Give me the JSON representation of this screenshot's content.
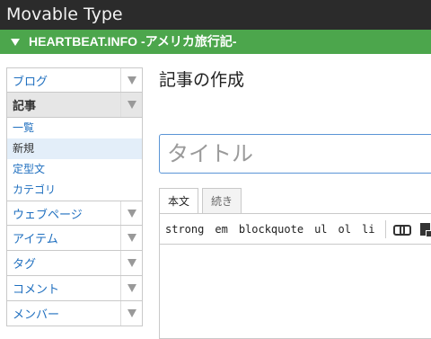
{
  "app": {
    "name": "Movable Type"
  },
  "site": {
    "name": "HEARTBEAT.INFO -アメリカ旅行記-"
  },
  "sidebar": {
    "groups": [
      {
        "label": "ブログ"
      },
      {
        "label": "記事"
      },
      {
        "label": "ウェブページ"
      },
      {
        "label": "アイテム"
      },
      {
        "label": "タグ"
      },
      {
        "label": "コメント"
      },
      {
        "label": "メンバー"
      }
    ],
    "article_items": [
      {
        "label": "一覧"
      },
      {
        "label": "新規"
      },
      {
        "label": "定型文"
      },
      {
        "label": "カテゴリ"
      }
    ]
  },
  "main": {
    "title": "記事の作成",
    "title_input": {
      "placeholder": "タイトル"
    },
    "tabs": [
      {
        "label": "本文"
      },
      {
        "label": "続き"
      }
    ],
    "toolbar": {
      "strong": "strong",
      "em": "em",
      "blockquote": "blockquote",
      "ul": "ul",
      "ol": "ol",
      "li": "li"
    }
  }
}
